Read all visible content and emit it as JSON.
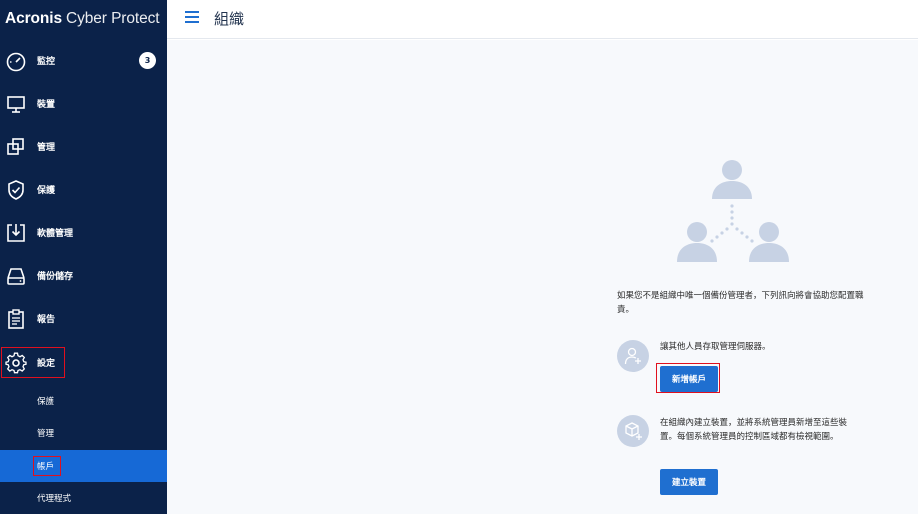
{
  "brand": {
    "name_bold": "Acronis",
    "name_light": "Cyber Protect"
  },
  "sidebar": {
    "items": [
      {
        "label": "監控",
        "icon": "gauge-icon",
        "badge": "3"
      },
      {
        "label": "裝置",
        "icon": "monitor-icon"
      },
      {
        "label": "管理",
        "icon": "manage-icon"
      },
      {
        "label": "保護",
        "icon": "shield-icon"
      },
      {
        "label": "軟體管理",
        "icon": "software-icon"
      },
      {
        "label": "備份儲存",
        "icon": "storage-icon"
      },
      {
        "label": "報告",
        "icon": "report-icon"
      },
      {
        "label": "設定",
        "icon": "gear-icon"
      }
    ],
    "sub_items": [
      {
        "label": "保護"
      },
      {
        "label": "管理"
      },
      {
        "label": "帳戶"
      },
      {
        "label": "代理程式"
      }
    ]
  },
  "header": {
    "title": "組織"
  },
  "main": {
    "intro": "如果您不是組織中唯一個備份管理者，下列訊向將會協助您配置職責。",
    "step1": {
      "text": "讓其他人員存取管理伺服器。",
      "button": "新增帳戶"
    },
    "step2": {
      "text": "在組織內建立裝置，並將系統管理員新增至這些裝置。每個系統管理員的控制區域都有檢視範圍。",
      "button": "建立裝置"
    }
  },
  "colors": {
    "sidebar": "#0b2249",
    "accent": "#1f6fd0",
    "active": "#1669d6",
    "highlight": "#e0101e"
  }
}
